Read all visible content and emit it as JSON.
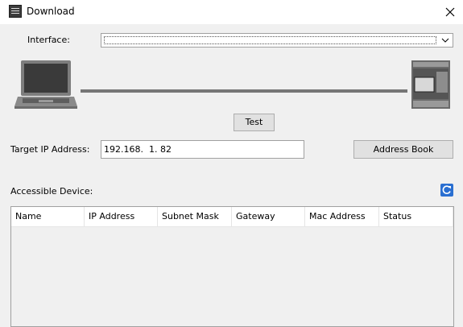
{
  "window": {
    "title": "Download",
    "icon": "app-icon",
    "close_icon": "close-icon"
  },
  "interface": {
    "label": "Interface:",
    "value": ""
  },
  "connection": {
    "test_label": "Test",
    "pc_icon": "laptop-icon",
    "plc_icon": "plc-device-icon"
  },
  "target": {
    "label": "Target IP Address:",
    "value": "192.168.  1. 82",
    "address_book_label": "Address Book"
  },
  "devices": {
    "label": "Accessible Device:",
    "refresh_icon": "refresh-icon",
    "columns": [
      "Name",
      "IP Address",
      "Subnet Mask",
      "Gateway",
      "Mac Address",
      "Status"
    ]
  },
  "colors": {
    "refresh_blue": "#2a6fd1",
    "line": "#767676"
  }
}
